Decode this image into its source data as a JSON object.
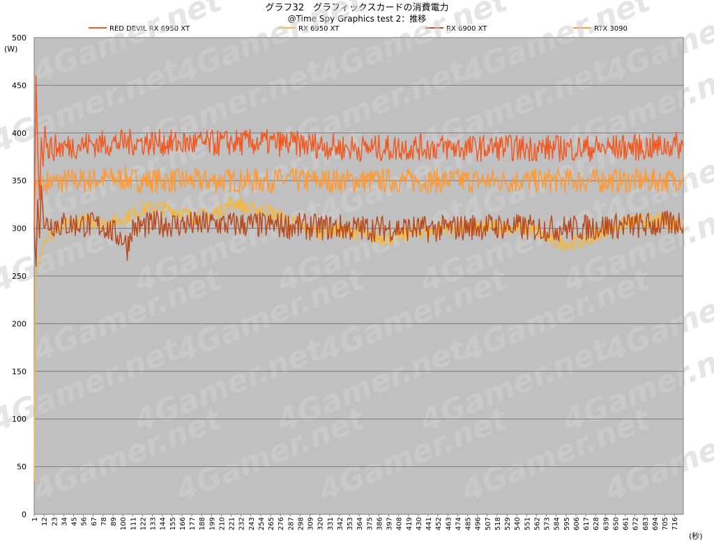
{
  "title": "グラフ32　グラフィックスカードの消費電力",
  "subtitle": "@Time Spy Graphics test 2：推移",
  "y_unit": "(W)",
  "x_unit": "(秒)",
  "watermark": "4Gamer.net",
  "chart_data": {
    "type": "line",
    "title": "グラフ32　グラフィックスカードの消費電力",
    "subtitle": "@Time Spy Graphics test 2：推移",
    "xlabel": "(秒)",
    "ylabel": "(W)",
    "ylim": [
      0,
      500
    ],
    "xlim": [
      1,
      726
    ],
    "grid": true,
    "legend_position": "top",
    "plot_background": "#c0c0c0",
    "yticks": [
      0,
      50,
      100,
      150,
      200,
      250,
      300,
      350,
      400,
      450,
      500
    ],
    "xtick_labels": [
      "1",
      "12",
      "23",
      "34",
      "45",
      "56",
      "67",
      "78",
      "89",
      "100",
      "111",
      "122",
      "133",
      "144",
      "155",
      "166",
      "177",
      "188",
      "199",
      "210",
      "221",
      "232",
      "243",
      "254",
      "265",
      "276",
      "287",
      "298",
      "309",
      "320",
      "331",
      "342",
      "353",
      "364",
      "375",
      "386",
      "397",
      "408",
      "419",
      "430",
      "441",
      "452",
      "463",
      "474",
      "485",
      "496",
      "507",
      "518",
      "529",
      "540",
      "551",
      "562",
      "573",
      "584",
      "595",
      "606",
      "617",
      "628",
      "639",
      "650",
      "661",
      "672",
      "683",
      "694",
      "705",
      "716"
    ],
    "series": [
      {
        "name": "RED DEVIL RX 6950 XT",
        "color": "#f05a22",
        "x": [
          1,
          3,
          5,
          7,
          9,
          11,
          13,
          15,
          20,
          30,
          40,
          50,
          60,
          80,
          100,
          120,
          140,
          160,
          180,
          200,
          220,
          240,
          260,
          280,
          300,
          320,
          340,
          360,
          380,
          400,
          420,
          440,
          460,
          480,
          500,
          520,
          540,
          560,
          580,
          600,
          620,
          640,
          660,
          680,
          700,
          715,
          726
        ],
        "values": [
          300,
          460,
          380,
          330,
          395,
          365,
          407,
          383,
          384,
          385,
          386,
          387,
          388,
          389,
          390,
          390,
          390,
          389,
          389,
          389,
          390,
          390,
          390,
          389,
          388,
          387,
          385,
          384,
          384,
          384,
          385,
          385,
          385,
          384,
          384,
          385,
          384,
          384,
          384,
          384,
          384,
          384,
          385,
          385,
          385,
          388,
          385
        ]
      },
      {
        "name": "RX 6950 XT",
        "color": "#f7b733",
        "x": [
          1,
          2,
          3,
          5,
          8,
          10,
          12,
          15,
          20,
          30,
          40,
          60,
          80,
          100,
          120,
          140,
          160,
          180,
          200,
          210,
          220,
          230,
          240,
          260,
          280,
          300,
          320,
          340,
          360,
          380,
          400,
          420,
          440,
          460,
          480,
          500,
          520,
          540,
          560,
          580,
          600,
          620,
          640,
          660,
          680,
          700,
          715,
          726
        ],
        "values": [
          35,
          240,
          255,
          262,
          270,
          275,
          285,
          290,
          292,
          300,
          305,
          308,
          305,
          310,
          320,
          322,
          318,
          312,
          315,
          320,
          326,
          326,
          320,
          320,
          310,
          302,
          296,
          298,
          296,
          290,
          290,
          294,
          296,
          300,
          300,
          300,
          302,
          300,
          298,
          286,
          284,
          288,
          298,
          305,
          308,
          308,
          305,
          305
        ]
      },
      {
        "name": "RX 6900 XT",
        "color": "#b94a1c",
        "x": [
          1,
          3,
          5,
          7,
          9,
          12,
          15,
          20,
          30,
          40,
          60,
          80,
          90,
          100,
          105,
          110,
          120,
          140,
          160,
          180,
          200,
          220,
          240,
          260,
          280,
          300,
          320,
          340,
          360,
          380,
          400,
          420,
          440,
          460,
          480,
          500,
          520,
          540,
          560,
          580,
          600,
          620,
          640,
          660,
          680,
          700,
          715,
          726
        ],
        "values": [
          300,
          260,
          330,
          290,
          345,
          300,
          305,
          305,
          304,
          304,
          304,
          302,
          295,
          290,
          280,
          300,
          302,
          305,
          304,
          304,
          305,
          304,
          304,
          303,
          303,
          302,
          301,
          301,
          300,
          300,
          300,
          300,
          299,
          300,
          301,
          302,
          302,
          301,
          300,
          300,
          300,
          301,
          302,
          303,
          303,
          304,
          305,
          308
        ]
      },
      {
        "name": "RTX 3090",
        "color": "#ff9933",
        "x": [
          1,
          3,
          5,
          8,
          10,
          12,
          15,
          20,
          40,
          60,
          80,
          100,
          120,
          140,
          160,
          180,
          200,
          220,
          240,
          260,
          280,
          300,
          320,
          340,
          360,
          380,
          400,
          420,
          440,
          460,
          480,
          500,
          520,
          540,
          560,
          580,
          600,
          620,
          640,
          660,
          680,
          700,
          715,
          726
        ],
        "values": [
          320,
          350,
          345,
          340,
          355,
          340,
          350,
          348,
          350,
          350,
          352,
          352,
          350,
          350,
          350,
          350,
          350,
          350,
          350,
          350,
          351,
          350,
          350,
          350,
          350,
          350,
          350,
          350,
          350,
          350,
          350,
          350,
          350,
          350,
          350,
          350,
          350,
          350,
          350,
          350,
          350,
          350,
          350,
          355
        ]
      }
    ]
  }
}
